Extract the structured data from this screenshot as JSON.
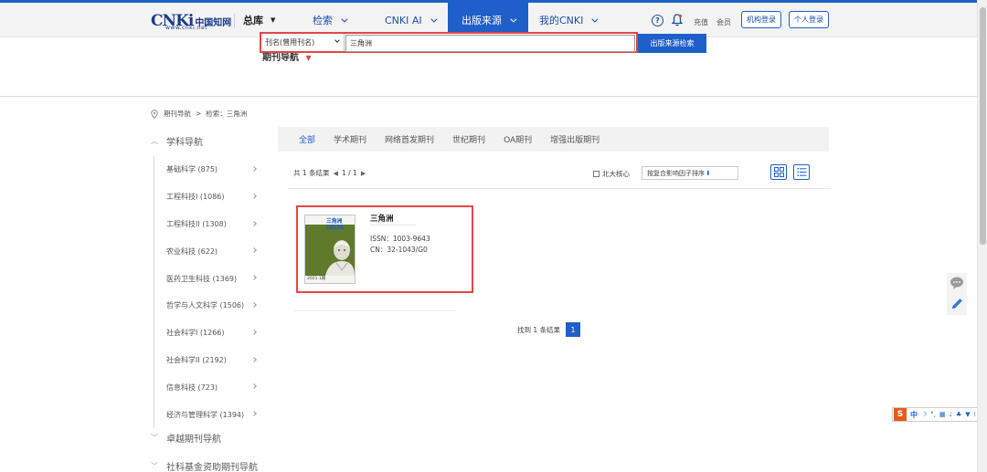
{
  "header": {
    "logo_mark": "CNKi",
    "logo_cn": "中国知网",
    "logo_url": "www.cnki.net",
    "nav": [
      {
        "label": "总库"
      },
      {
        "label": "检索"
      },
      {
        "label": "CNKI AI"
      },
      {
        "label": "出版来源",
        "active": true
      },
      {
        "label": "我的CNKI"
      }
    ],
    "help_icon": "?",
    "recharge": "充值",
    "member": "会员",
    "org_login": "机构登录",
    "personal_login": "个人登录"
  },
  "search": {
    "section_title": "期刊导航",
    "field_select": "刊名(曾用刊名)",
    "query": "三角洲",
    "button": "出版来源检索"
  },
  "breadcrumb": {
    "root": "期刊导航",
    "separator": ">",
    "current": "检索：三角洲"
  },
  "sidebar": {
    "subject_nav": "学科导航",
    "items": [
      {
        "label": "基础科学 (875)"
      },
      {
        "label": "工程科技I (1086)"
      },
      {
        "label": "工程科技II (1308)"
      },
      {
        "label": "农业科技 (622)"
      },
      {
        "label": "医药卫生科技 (1369)"
      },
      {
        "label": "哲学与人文科学 (1506)"
      },
      {
        "label": "社会科学I (1266)"
      },
      {
        "label": "社会科学II (2192)"
      },
      {
        "label": "信息科技 (723)"
      },
      {
        "label": "经济与管理科学 (1394)"
      }
    ],
    "excellence_nav": "卓越期刊导航",
    "fund_nav": "社科基金资助期刊导航"
  },
  "tabs": [
    {
      "label": "全部",
      "active": true
    },
    {
      "label": "学术期刊"
    },
    {
      "label": "网络首发期刊"
    },
    {
      "label": "世纪期刊"
    },
    {
      "label": "OA期刊"
    },
    {
      "label": "增强出版期刊"
    }
  ],
  "results": {
    "prefix": "共",
    "count": "1",
    "suffix": "条结果",
    "page_current": "1",
    "page_sep": "/",
    "page_total": "1",
    "core_checkbox": "北大核心",
    "sort": "按复合影响因子排序"
  },
  "journal": {
    "title": "三角洲",
    "issn": "ISSN：1003-9643",
    "cn": "CN：32-1043/G0",
    "cover_logo": "三角洲 DELTA",
    "cover_bottom": "2021 1期"
  },
  "pagination": {
    "found": "找到",
    "count": "1",
    "unit": "条结果",
    "page": "1"
  },
  "ime": {
    "logo": "S",
    "mode": "中"
  },
  "colors": {
    "brand_blue": "#1f5fca",
    "highlight_red": "#e04848"
  }
}
